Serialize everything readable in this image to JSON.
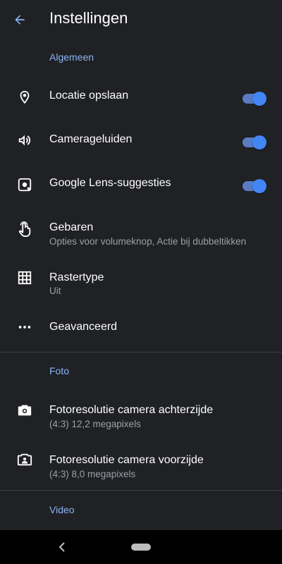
{
  "header": {
    "title": "Instellingen",
    "back_icon": "arrow-back-icon"
  },
  "sections": {
    "general": "Algemeen",
    "photo": "Foto",
    "video": "Video"
  },
  "settings": {
    "location": {
      "label": "Locatie opslaan",
      "icon": "location-pin-icon",
      "enabled": true
    },
    "sounds": {
      "label": "Camerageluiden",
      "icon": "speaker-icon",
      "enabled": true
    },
    "lens": {
      "label": "Google Lens-suggesties",
      "icon": "lens-icon",
      "enabled": true
    },
    "gestures": {
      "label": "Gebaren",
      "sub": "Opties voor volumeknop, Actie bij dubbeltikken",
      "icon": "touch-gesture-icon"
    },
    "grid": {
      "label": "Rastertype",
      "sub": "Uit",
      "icon": "grid-icon"
    },
    "advanced": {
      "label": "Geavanceerd",
      "icon": "more-horiz-icon"
    },
    "rear_resolution": {
      "label": "Fotoresolutie camera achterzijde",
      "sub": "(4:3) 12,2 megapixels",
      "icon": "camera-rear-icon"
    },
    "front_resolution": {
      "label": "Fotoresolutie camera voorzijde",
      "sub": "(4:3) 8,0 megapixels",
      "icon": "camera-front-icon"
    }
  },
  "colors": {
    "accent": "#8ab4f8",
    "toggle_thumb": "#4285f4",
    "background": "#202124"
  }
}
